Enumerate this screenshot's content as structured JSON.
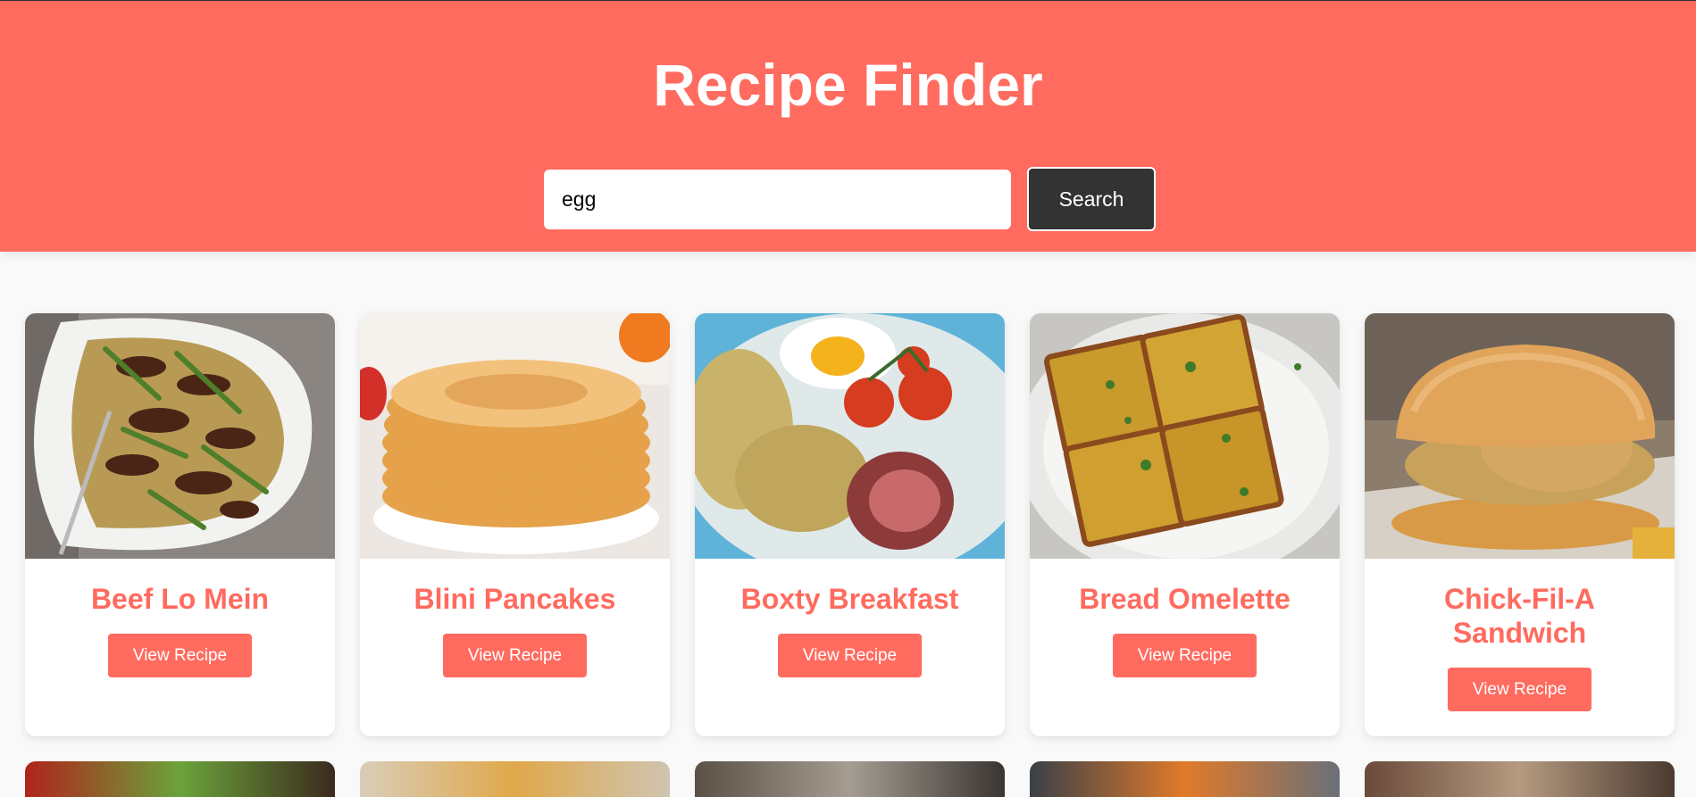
{
  "header": {
    "title": "Recipe Finder"
  },
  "search": {
    "value": "egg",
    "placeholder": "",
    "button_label": "Search"
  },
  "colors": {
    "accent": "#ff6b5f",
    "button_dark": "#333333"
  },
  "recipes": [
    {
      "title": "Beef Lo Mein",
      "button_label": "View Recipe"
    },
    {
      "title": "Blini Pancakes",
      "button_label": "View Recipe"
    },
    {
      "title": "Boxty Breakfast",
      "button_label": "View Recipe"
    },
    {
      "title": "Bread Omelette",
      "button_label": "View Recipe"
    },
    {
      "title": "Chick-Fil-A Sandwich",
      "button_label": "View Recipe"
    }
  ]
}
